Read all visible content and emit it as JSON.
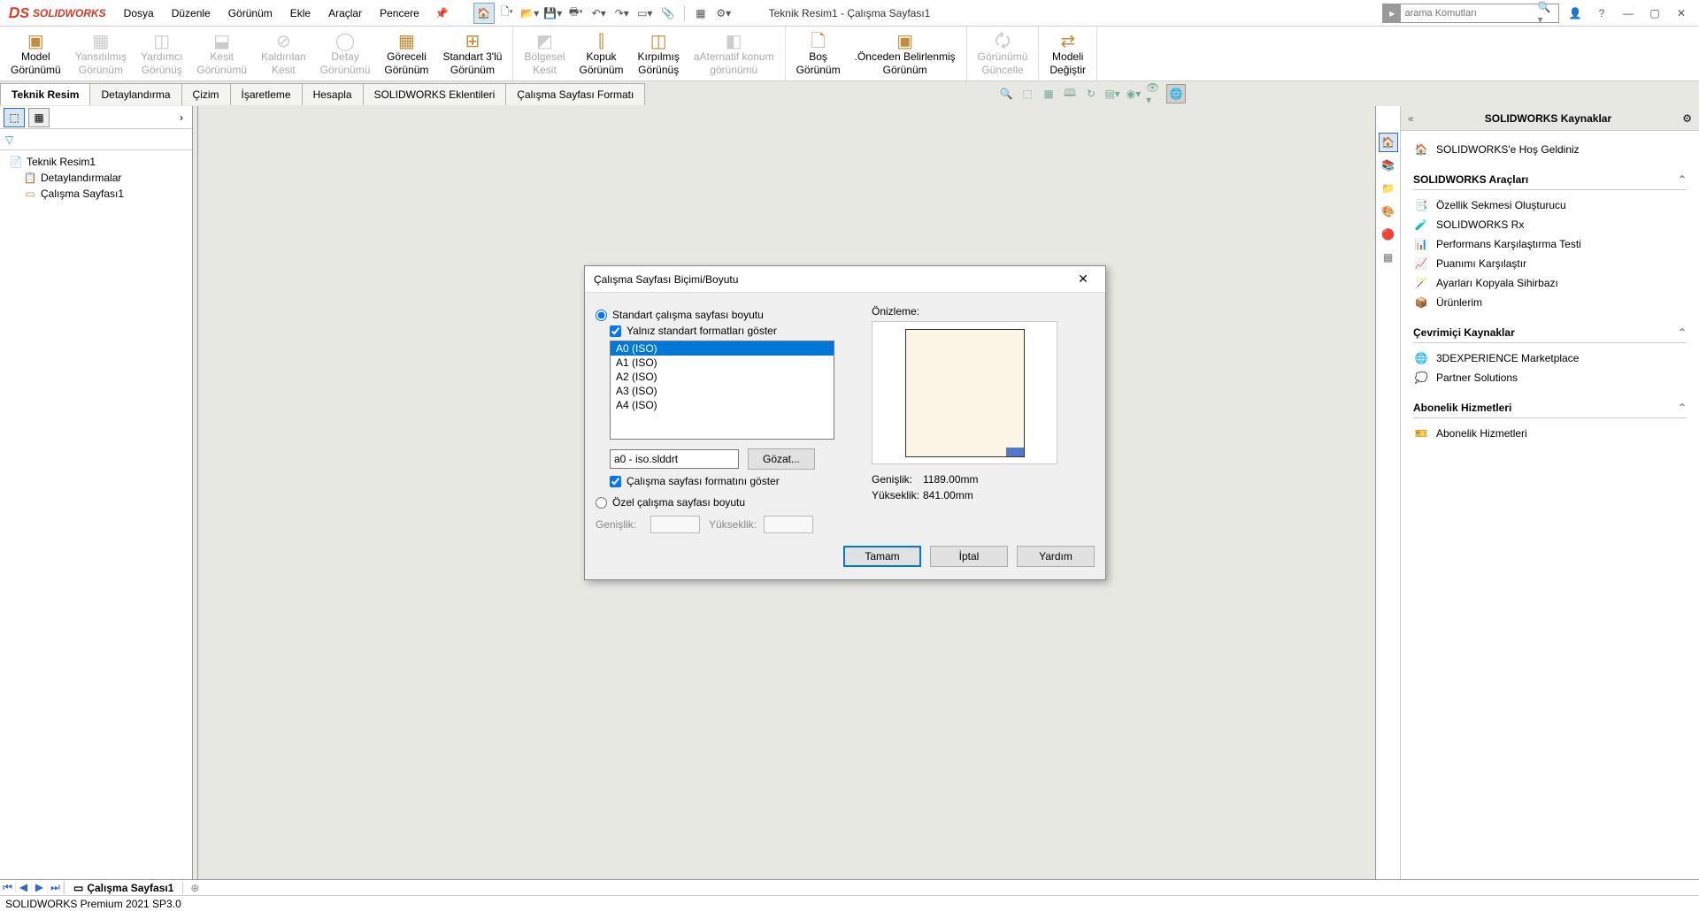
{
  "app": {
    "name": "SOLIDWORKS",
    "doc_title": "Teknik Resim1 - Çalışma Sayfası1",
    "search_placeholder": "arama Komutları"
  },
  "menus": [
    "Dosya",
    "Düzenle",
    "Görünüm",
    "Ekle",
    "Araçlar",
    "Pencere"
  ],
  "ribbon": [
    {
      "label": "Model\nGörünümü",
      "enabled": true
    },
    {
      "label": "Yansıtılmış\nGörünüm",
      "enabled": false
    },
    {
      "label": "Yardımcı\nGörünüş",
      "enabled": false
    },
    {
      "label": "Kesit\nGörünümü",
      "enabled": false
    },
    {
      "label": "Kaldırılan\nKesit",
      "enabled": false
    },
    {
      "label": "Detay\nGörünümü",
      "enabled": false
    },
    {
      "label": "Göreceli\nGörünüm",
      "enabled": true
    },
    {
      "label": "Standart 3'lü\nGörünüm",
      "enabled": true
    },
    {
      "label": "Bölgesel\nKesit",
      "enabled": false
    },
    {
      "label": "Kopuk\nGörünüm",
      "enabled": true
    },
    {
      "label": "Kırpılmış\nGörünüş",
      "enabled": true
    },
    {
      "label": "aAternatif konum\ngörünümü",
      "enabled": false
    },
    {
      "label": "Boş\nGörünüm",
      "enabled": true
    },
    {
      "label": ".Önceden Belirlenmiş\nGörünüm",
      "enabled": true
    },
    {
      "label": "Görünümü\nGüncelle",
      "enabled": false
    },
    {
      "label": "Modeli\nDeğiştir",
      "enabled": true
    }
  ],
  "tabs": [
    "Teknik Resim",
    "Detaylandırma",
    "Çizim",
    "İşaretleme",
    "Hesapla",
    "SOLIDWORKS Eklentileri",
    "Çalışma Sayfası Formatı"
  ],
  "tree": {
    "root": "Teknik Resim1",
    "items": [
      "Detaylandırmalar",
      "Çalışma Sayfası1"
    ]
  },
  "task_pane": {
    "title": "SOLIDWORKS Kaynaklar",
    "welcome": "SOLIDWORKS'e Hoş Geldiniz",
    "sections": {
      "tools": {
        "title": "SOLIDWORKS Araçları",
        "items": [
          "Özellik Sekmesi Oluşturucu",
          "SOLIDWORKS Rx",
          "Performans Karşılaştırma Testi",
          "Puanımı Karşılaştır",
          "Ayarları Kopyala Sihirbazı",
          "Ürünlerim"
        ]
      },
      "online": {
        "title": "Çevrimiçi Kaynaklar",
        "items": [
          "3DEXPERIENCE Marketplace",
          "Partner Solutions"
        ]
      },
      "sub": {
        "title": "Abonelik Hizmetleri",
        "items": [
          "Abonelik Hizmetleri"
        ]
      }
    }
  },
  "sheet_tab": "Çalışma Sayfası1",
  "status": "SOLIDWORKS Premium 2021 SP3.0",
  "dialog": {
    "title": "Çalışma Sayfası Biçimi/Boyutu",
    "radio_standard": "Standart çalışma sayfası boyutu",
    "check_only_standard": "Yalnız standart formatları göster",
    "sizes": [
      "A0 (ISO)",
      "A1 (ISO)",
      "A2 (ISO)",
      "A3 (ISO)",
      "A4 (ISO)"
    ],
    "filename": "a0 - iso.slddrt",
    "browse": "Gözat...",
    "check_show_format": "Çalışma sayfası formatını göster",
    "radio_custom": "Özel çalışma sayfası boyutu",
    "width_label": "Genişlik:",
    "height_label": "Yükseklik:",
    "preview_label": "Önizleme:",
    "info_width_label": "Genişlik:",
    "info_width_value": "1189.00mm",
    "info_height_label": "Yükseklik:",
    "info_height_value": "841.00mm",
    "ok": "Tamam",
    "cancel": "İptal",
    "help": "Yardım"
  }
}
